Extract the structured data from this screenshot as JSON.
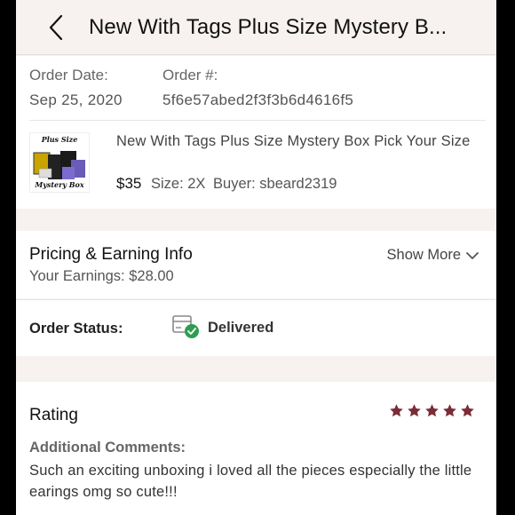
{
  "header": {
    "title": "New With Tags Plus Size Mystery B..."
  },
  "order": {
    "date_label": "Order Date:",
    "date_value": "Sep 25, 2020",
    "number_label": "Order #:",
    "number_value": "5f6e57abed2f3f3b6d4616f5"
  },
  "item": {
    "thumb_text_top": "Plus Size",
    "thumb_text_bottom": "Mystery Box",
    "title": "New With Tags Plus Size Mystery Box Pick Your Size",
    "price": "$35",
    "size": "Size: 2X",
    "buyer": "Buyer: sbeard2319"
  },
  "pricing": {
    "title": "Pricing & Earning Info",
    "earnings": "Your Earnings: $28.00",
    "show_more": "Show More"
  },
  "status": {
    "label": "Order Status:",
    "value": "Delivered",
    "icon": "delivered-box-icon",
    "icon_color": "#2e9e4f"
  },
  "rating": {
    "title": "Rating",
    "stars": 5,
    "star_color": "#7a2d36",
    "comments_label": "Additional Comments:",
    "comments": "Such an exciting unboxing i loved all the pieces especially the little earings omg so cute!!!"
  }
}
